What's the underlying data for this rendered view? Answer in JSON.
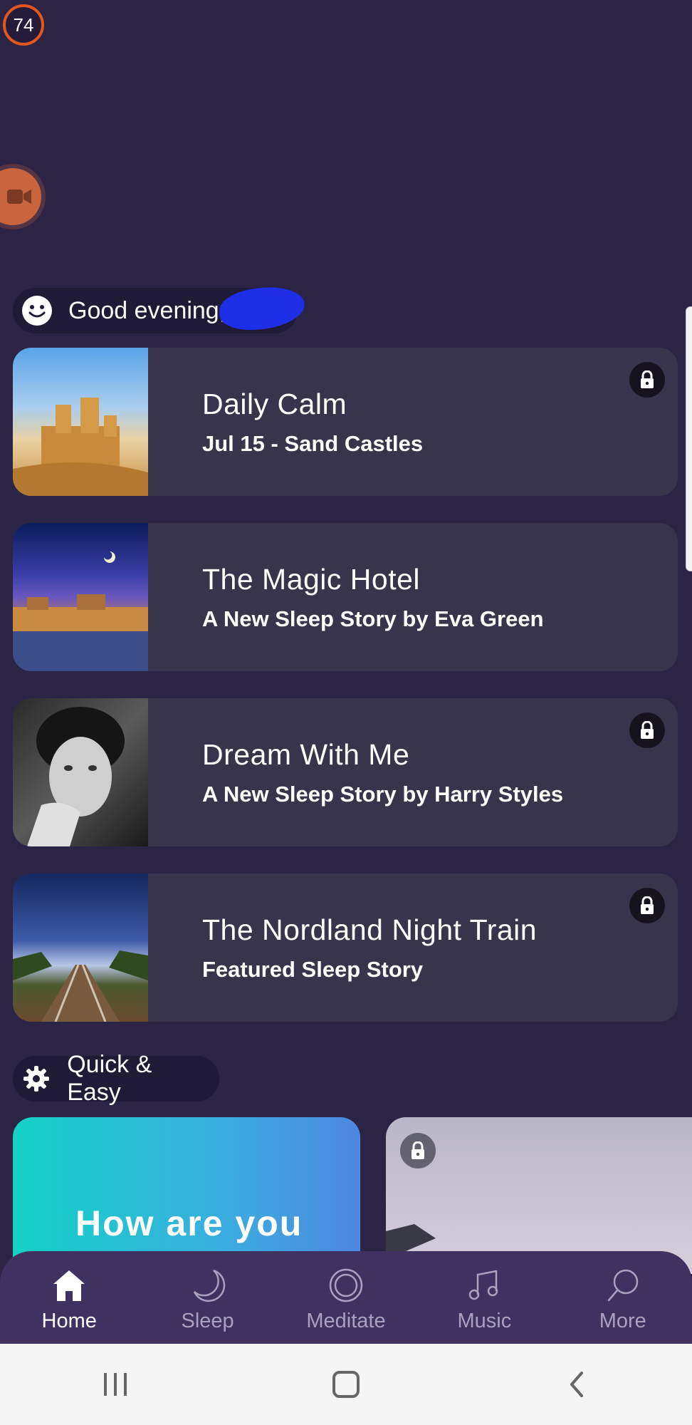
{
  "status": {
    "badge_value": "74"
  },
  "greeting": {
    "text": "Good evening,"
  },
  "cards": [
    {
      "title": "Daily Calm",
      "subtitle": "Jul 15 - Sand Castles",
      "locked": true,
      "image": "sand-castles-image"
    },
    {
      "title": "The Magic Hotel",
      "subtitle": "A New Sleep Story by Eva Green",
      "locked": false,
      "image": "night-hotel-image"
    },
    {
      "title": "Dream With Me",
      "subtitle": "A New Sleep Story by Harry Styles",
      "locked": true,
      "image": "portrait-image"
    },
    {
      "title": "The Nordland Night Train",
      "subtitle": "Featured Sleep Story",
      "locked": true,
      "image": "railway-night-image"
    }
  ],
  "quick_easy": {
    "label": "Quick & Easy",
    "tiles": [
      {
        "text": "How are you",
        "locked": false
      },
      {
        "text": "",
        "locked": true
      }
    ]
  },
  "tabs": [
    {
      "label": "Home",
      "icon": "home-icon",
      "active": true
    },
    {
      "label": "Sleep",
      "icon": "moon-icon",
      "active": false
    },
    {
      "label": "Meditate",
      "icon": "circle-icon",
      "active": false
    },
    {
      "label": "Music",
      "icon": "music-note-icon",
      "active": false
    },
    {
      "label": "More",
      "icon": "search-icon",
      "active": false
    }
  ],
  "system_nav": [
    "recents-icon",
    "home-button-icon",
    "back-icon"
  ],
  "colors": {
    "background": "#2b2445",
    "card": "#37344c",
    "tabbar": "#3f3160",
    "accent_orange": "#e2571e",
    "tile_gradient_start": "#12d2c4",
    "tile_gradient_end": "#4e86e0"
  }
}
